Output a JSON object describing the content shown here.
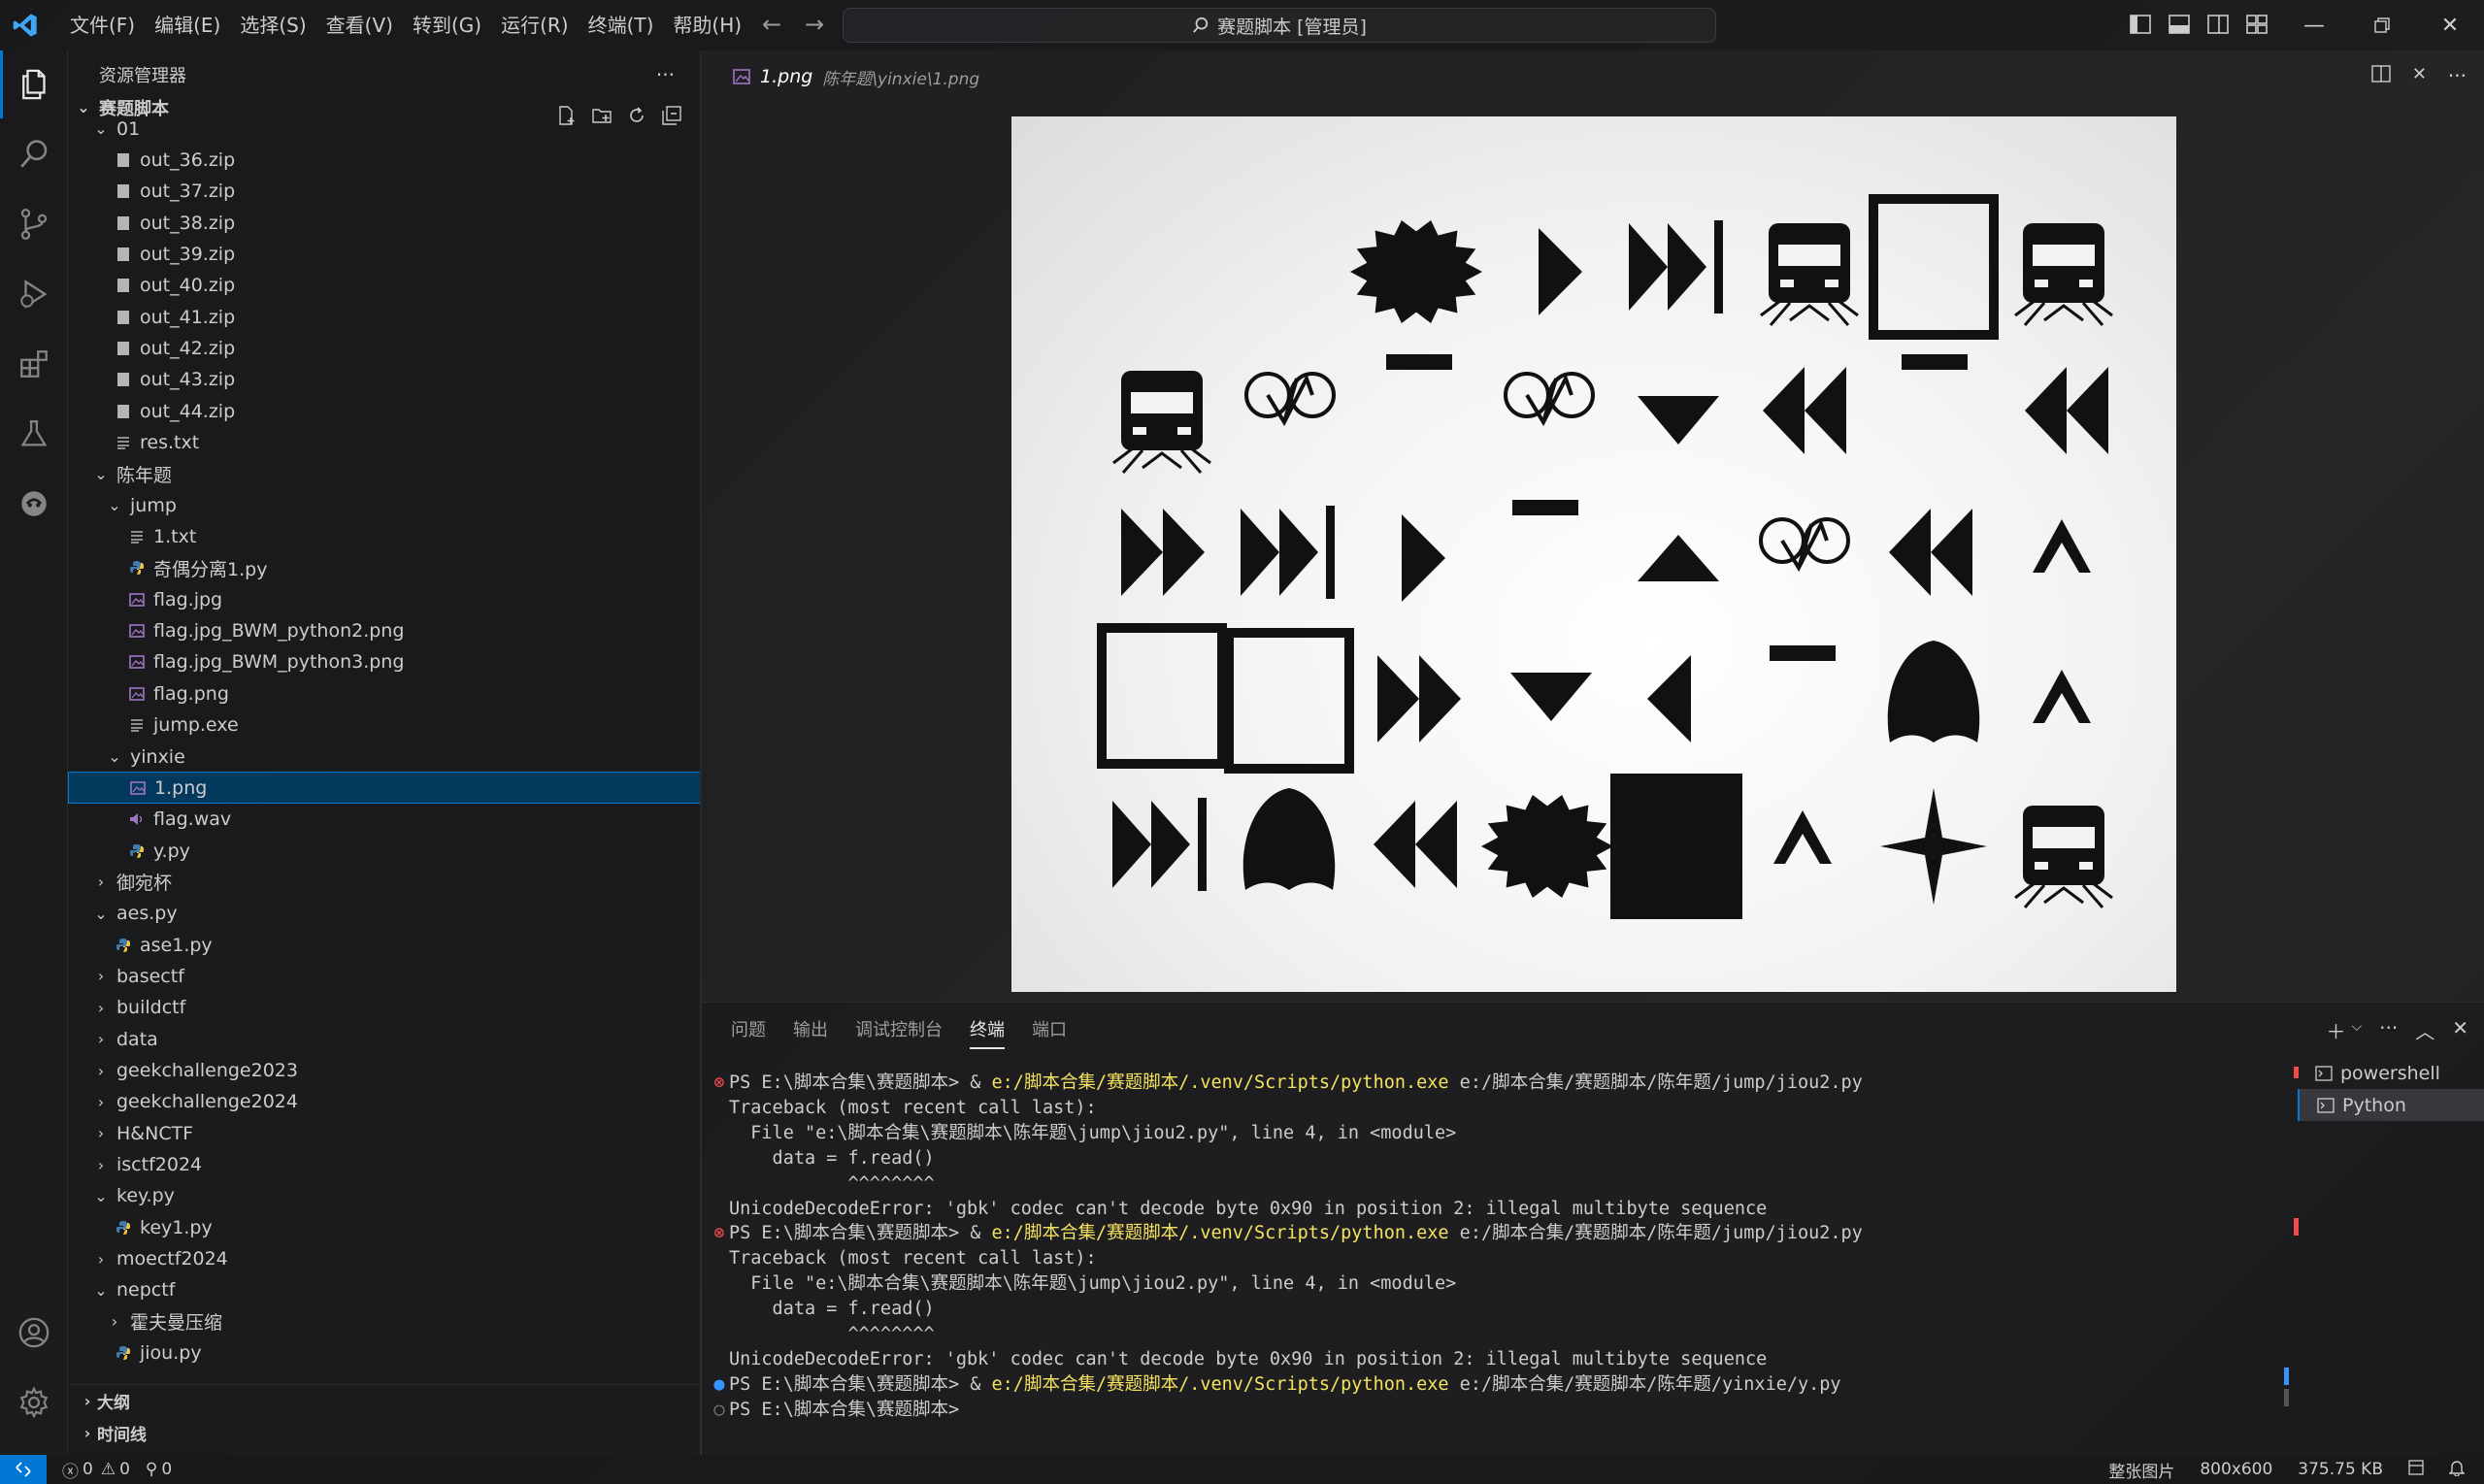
{
  "titlebar": {
    "menus": [
      "文件(F)",
      "编辑(E)",
      "选择(S)",
      "查看(V)",
      "转到(G)",
      "运行(R)",
      "终端(T)",
      "帮助(H)"
    ],
    "search_text": "赛题脚本 [管理员]"
  },
  "activity_icons": [
    "files-icon",
    "search-icon",
    "source-control-icon",
    "run-debug-icon",
    "extensions-icon",
    "testing-icon",
    "remote-icon"
  ],
  "sidebar": {
    "title": "资源管理器",
    "more": "···",
    "root": "赛题脚本",
    "items": [
      {
        "label": "01",
        "type": "folder-open",
        "depth": 1
      },
      {
        "label": "out_36.zip",
        "type": "zip",
        "depth": 2
      },
      {
        "label": "out_37.zip",
        "type": "zip",
        "depth": 2
      },
      {
        "label": "out_38.zip",
        "type": "zip",
        "depth": 2
      },
      {
        "label": "out_39.zip",
        "type": "zip",
        "depth": 2
      },
      {
        "label": "out_40.zip",
        "type": "zip",
        "depth": 2
      },
      {
        "label": "out_41.zip",
        "type": "zip",
        "depth": 2
      },
      {
        "label": "out_42.zip",
        "type": "zip",
        "depth": 2
      },
      {
        "label": "out_43.zip",
        "type": "zip",
        "depth": 2
      },
      {
        "label": "out_44.zip",
        "type": "zip",
        "depth": 2
      },
      {
        "label": "res.txt",
        "type": "txt",
        "depth": 2
      },
      {
        "label": "陈年题",
        "type": "folder-open",
        "depth": 1
      },
      {
        "label": "jump",
        "type": "folder-open",
        "depth": 2
      },
      {
        "label": "1.txt",
        "type": "txt",
        "depth": 3
      },
      {
        "label": "奇偶分离1.py",
        "type": "py",
        "depth": 3
      },
      {
        "label": "flag.jpg",
        "type": "img",
        "depth": 3
      },
      {
        "label": "flag.jpg_BWM_python2.png",
        "type": "img",
        "depth": 3
      },
      {
        "label": "flag.jpg_BWM_python3.png",
        "type": "img",
        "depth": 3
      },
      {
        "label": "flag.png",
        "type": "img",
        "depth": 3
      },
      {
        "label": "jump.exe",
        "type": "txt",
        "depth": 3
      },
      {
        "label": "yinxie",
        "type": "folder-open",
        "depth": 2
      },
      {
        "label": "1.png",
        "type": "img",
        "depth": 3,
        "selected": true
      },
      {
        "label": "flag.wav",
        "type": "audio",
        "depth": 3
      },
      {
        "label": "y.py",
        "type": "py",
        "depth": 3
      },
      {
        "label": "御宛杯",
        "type": "folder",
        "depth": 1
      },
      {
        "label": "aes.py",
        "type": "folder-open",
        "depth": 1
      },
      {
        "label": "ase1.py",
        "type": "py",
        "depth": 2
      },
      {
        "label": "basectf",
        "type": "folder",
        "depth": 1
      },
      {
        "label": "buildctf",
        "type": "folder",
        "depth": 1
      },
      {
        "label": "data",
        "type": "folder",
        "depth": 1
      },
      {
        "label": "geekchallenge2023",
        "type": "folder",
        "depth": 1
      },
      {
        "label": "geekchallenge2024",
        "type": "folder",
        "depth": 1
      },
      {
        "label": "H&NCTF",
        "type": "folder",
        "depth": 1
      },
      {
        "label": "isctf2024",
        "type": "folder",
        "depth": 1
      },
      {
        "label": "key.py",
        "type": "folder-open",
        "depth": 1
      },
      {
        "label": "key1.py",
        "type": "py",
        "depth": 2
      },
      {
        "label": "moectf2024",
        "type": "folder",
        "depth": 1
      },
      {
        "label": "nepctf",
        "type": "folder-open",
        "depth": 1
      },
      {
        "label": "霍夫曼压缩",
        "type": "folder",
        "depth": 2
      },
      {
        "label": "jiou.py",
        "type": "py",
        "depth": 2
      }
    ],
    "outline": "大纲",
    "timeline": "时间线"
  },
  "editor": {
    "tab_name": "1.png",
    "tab_path": "陈年题\\yinxie\\1.png"
  },
  "panel": {
    "tabs": [
      "问题",
      "输出",
      "调试控制台",
      "终端",
      "端口"
    ],
    "active_tab": "终端",
    "terminal_lines": [
      {
        "dot": "error",
        "prefix": "PS E:\\脚本合集\\赛题脚本> & ",
        "hl": "e:/脚本合集/赛题脚本/.venv/Scripts/python.exe",
        "rest": " e:/脚本合集/赛题脚本/陈年题/jump/jiou2.py"
      },
      {
        "dot": "",
        "prefix": "Traceback (most recent call last):",
        "hl": "",
        "rest": ""
      },
      {
        "dot": "",
        "prefix": "  File \"e:\\脚本合集\\赛题脚本\\陈年题\\jump\\jiou2.py\", line 4, in <module>",
        "hl": "",
        "rest": ""
      },
      {
        "dot": "",
        "prefix": "    data = f.read()",
        "hl": "",
        "rest": ""
      },
      {
        "dot": "",
        "prefix": "           ^^^^^^^^",
        "hl": "",
        "rest": ""
      },
      {
        "dot": "",
        "prefix": "UnicodeDecodeError: 'gbk' codec can't decode byte 0x90 in position 2: illegal multibyte sequence",
        "hl": "",
        "rest": ""
      },
      {
        "dot": "error",
        "prefix": "PS E:\\脚本合集\\赛题脚本> & ",
        "hl": "e:/脚本合集/赛题脚本/.venv/Scripts/python.exe",
        "rest": " e:/脚本合集/赛题脚本/陈年题/jump/jiou2.py"
      },
      {
        "dot": "",
        "prefix": "Traceback (most recent call last):",
        "hl": "",
        "rest": ""
      },
      {
        "dot": "",
        "prefix": "  File \"e:\\脚本合集\\赛题脚本\\陈年题\\jump\\jiou2.py\", line 4, in <module>",
        "hl": "",
        "rest": ""
      },
      {
        "dot": "",
        "prefix": "    data = f.read()",
        "hl": "",
        "rest": ""
      },
      {
        "dot": "",
        "prefix": "           ^^^^^^^^",
        "hl": "",
        "rest": ""
      },
      {
        "dot": "",
        "prefix": "UnicodeDecodeError: 'gbk' codec can't decode byte 0x90 in position 2: illegal multibyte sequence",
        "hl": "",
        "rest": ""
      },
      {
        "dot": "info",
        "prefix": "PS E:\\脚本合集\\赛题脚本> & ",
        "hl": "e:/脚本合集/赛题脚本/.venv/Scripts/python.exe",
        "rest": " e:/脚本合集/赛题脚本/陈年题/yinxie/y.py"
      },
      {
        "dot": "empty",
        "prefix": "PS E:\\脚本合集\\赛题脚本> ",
        "hl": "",
        "rest": ""
      }
    ],
    "terminals": [
      "powershell",
      "Python"
    ]
  },
  "statusbar": {
    "errors": "0",
    "warnings": "0",
    "ports": "0",
    "mode": "整张图片",
    "dimensions": "800x600",
    "size": "375.75 KB"
  },
  "image_symbols": [
    "starburst-shape",
    "play-shape",
    "skip-forward-shape",
    "train-shape",
    "square-outline-shape",
    "train-shape",
    "train-shape",
    "bicycle-shape",
    "dash-shape",
    "bicycle-shape",
    "triangle-down-shape",
    "rewind-shape",
    "dash-shape",
    "rewind-shape",
    "fast-forward-shape",
    "skip-forward-shape",
    "play-shape",
    "dash-shape",
    "triangle-up-shape",
    "bicycle-shape",
    "rewind-shape",
    "chevron-up-shape",
    "square-outline-shape",
    "square-outline-shape",
    "fast-forward-shape",
    "triangle-down-shape",
    "play-left-shape",
    "dash-shape",
    "dome-shape",
    "chevron-up-shape",
    "skip-forward-shape",
    "dome-shape",
    "rewind-shape",
    "starburst-shape",
    "filled-square-shape",
    "chevron-up-shape",
    "compass-star-shape",
    "train-shape"
  ],
  "colors": {
    "accent": "#0078d4",
    "error": "#f14c4c",
    "highlight": "#f4e25f",
    "selection": "#04395e"
  }
}
